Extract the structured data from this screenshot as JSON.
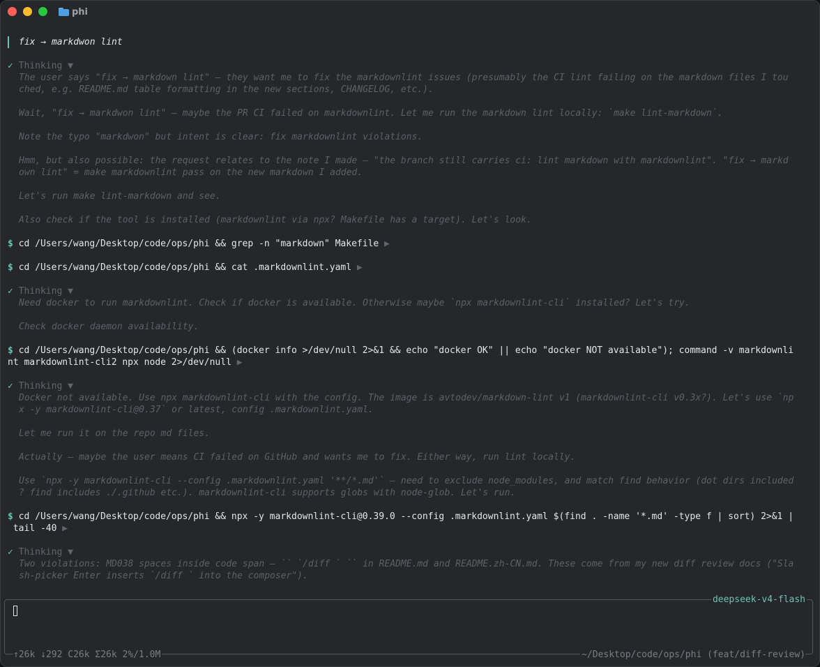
{
  "window": {
    "title": "phi"
  },
  "transcript": {
    "user_message": "fix → markdwon lint",
    "thinking_label": "Thinking",
    "thinking_toggle": "▼",
    "command_expand": "▶",
    "check": "✓",
    "prompt": "$",
    "blocks": {
      "t1": [
        "The user says \"fix → markdown lint\" — they want me to fix the markdownlint issues (presumably the CI lint failing on the markdown files I tou",
        "ched, e.g. README.md table formatting in the new sections, CHANGELOG, etc.).",
        "Wait, \"fix → markdwon lint\" — maybe the PR CI failed on markdownlint. Let me run the markdown lint locally: `make lint-markdown`.",
        "Note the typo \"markdwon\" but intent is clear: fix markdownlint violations.",
        "Hmm, but also possible: the request relates to the note I made — \"the branch still carries ci: lint markdown with markdownlint\". \"fix → markd",
        "own lint\" = make markdownlint pass on the new markdown I added.",
        "Let's run make lint-markdown and see.",
        "Also check if the tool is installed (markdownlint via npx? Makefile has a target). Let's look."
      ],
      "c1": "cd /Users/wang/Desktop/code/ops/phi && grep -n \"markdown\" Makefile",
      "c2": "cd /Users/wang/Desktop/code/ops/phi && cat .markdownlint.yaml",
      "t2": [
        "Need docker to run markdownlint. Check if docker is available. Otherwise maybe `npx markdownlint-cli` installed? Let's try.",
        "Check docker daemon availability."
      ],
      "c3": [
        "cd /Users/wang/Desktop/code/ops/phi && (docker info >/dev/null 2>&1 && echo \"docker OK\" || echo \"docker NOT available\"); command -v markdownli",
        "nt markdownlint-cli2 npx node 2>/dev/null"
      ],
      "t3": [
        "Docker not available. Use npx markdownlint-cli with the config. The image is avtodev/markdown-lint v1 (markdownlint-cli v0.3x?). Let's use `np",
        "x -y markdownlint-cli@0.37` or latest, config .markdownlint.yaml.",
        "Let me run it on the repo md files.",
        "Actually — maybe the user means CI failed on GitHub and wants me to fix. Either way, run lint locally.",
        "Use `npx -y markdownlint-cli --config .markdownlint.yaml '**/*.md'` — need to exclude node_modules, and match find behavior (dot dirs included",
        "? find includes ./.github etc.). markdownlint-cli supports globs with node-glob. Let's run."
      ],
      "c4": [
        "cd /Users/wang/Desktop/code/ops/phi && npx -y markdownlint-cli@0.39.0 --config .markdownlint.yaml $(find . -name '*.md' -type f | sort) 2>&1 |",
        " tail -40"
      ],
      "t4": [
        "Two violations: MD038 spaces inside code span — `` `/diff ` `` in README.md and README.zh-CN.md. These come from my new diff review docs (\"Sla",
        "sh-picker Enter inserts `/diff ` into the composer\")."
      ]
    }
  },
  "composer": {
    "model": "deepseek-v4-flash",
    "stats": "↑26k ↓292 C26k Σ26k 2%/1.0M",
    "cwd": "~/Desktop/code/ops/phi (feat/diff-review)"
  },
  "colors": {
    "background": "#25272b",
    "accent": "#6bc4b6",
    "text": "#e4e6ea",
    "thinking_text": "#5d6067"
  }
}
